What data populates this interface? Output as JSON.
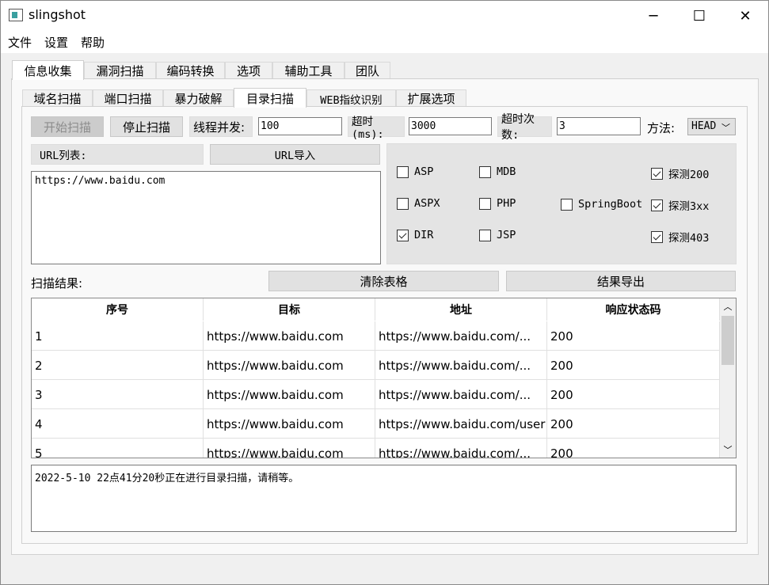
{
  "window": {
    "title": "slingshot"
  },
  "menu": [
    "文件",
    "设置",
    "帮助"
  ],
  "main_tabs": [
    "信息收集",
    "漏洞扫描",
    "编码转换",
    "选项",
    "辅助工具",
    "团队"
  ],
  "sub_tabs": [
    "域名扫描",
    "端口扫描",
    "暴力破解",
    "目录扫描",
    "WEB指纹识别",
    "扩展选项"
  ],
  "controls": {
    "start_label": "开始扫描",
    "stop_label": "停止扫描",
    "threads_label": "线程并发:",
    "threads_value": "100",
    "timeout_label": "超时(ms):",
    "timeout_value": "3000",
    "retries_label": "超时次数:",
    "retries_value": "3",
    "method_label": "方法:",
    "method_value": "HEAD"
  },
  "url": {
    "list_label": "URL列表:",
    "import_label": "URL导入",
    "text": "https://www.baidu.com"
  },
  "options": {
    "asp": "ASP",
    "aspx": "ASPX",
    "dir": "DIR",
    "mdb": "MDB",
    "php": "PHP",
    "jsp": "JSP",
    "springboot": "SpringBoot",
    "probe200": "探测200",
    "probe3xx": "探测3xx",
    "probe403": "探测403"
  },
  "results": {
    "label": "扫描结果:",
    "clear_label": "清除表格",
    "export_label": "结果导出",
    "columns": [
      "序号",
      "目标",
      "地址",
      "响应状态码"
    ],
    "rows": [
      [
        "1",
        "https://www.baidu.com",
        "https://www.baidu.com/...",
        "200"
      ],
      [
        "2",
        "https://www.baidu.com",
        "https://www.baidu.com/...",
        "200"
      ],
      [
        "3",
        "https://www.baidu.com",
        "https://www.baidu.com/...",
        "200"
      ],
      [
        "4",
        "https://www.baidu.com",
        "https://www.baidu.com/user",
        "200"
      ],
      [
        "5",
        "https://www.baidu.com",
        "https://www.baidu.com/...",
        "200"
      ]
    ]
  },
  "log": {
    "text": "2022-5-10 22点41分20秒正在进行目录扫描，请稍等。"
  }
}
